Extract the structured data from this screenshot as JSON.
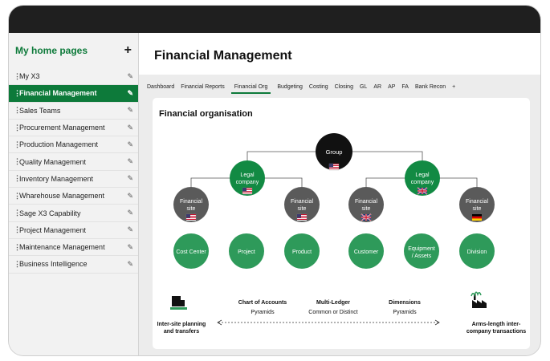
{
  "sidebar": {
    "title": "My home pages",
    "add_icon": "plus-icon",
    "items": [
      {
        "label": "My X3"
      },
      {
        "label": "Financial Management",
        "active": true
      },
      {
        "label": "Sales Teams"
      },
      {
        "label": "Procurement Management"
      },
      {
        "label": "Production Management"
      },
      {
        "label": "Quality Management"
      },
      {
        "label": "Inventory Management"
      },
      {
        "label": "Wharehouse Management"
      },
      {
        "label": "Sage X3 Capability"
      },
      {
        "label": "Project Management"
      },
      {
        "label": "Maintenance Management"
      },
      {
        "label": "Business Intelligence"
      }
    ]
  },
  "page": {
    "title": "Financial Management"
  },
  "tabs": [
    "Dashboard",
    "Financial Reports",
    "Financial Org",
    "Budgeting",
    "Costing",
    "Closing",
    "GL",
    "AR",
    "AP",
    "FA",
    "Bank Recon",
    "+"
  ],
  "active_tab": "Financial Org",
  "card": {
    "title": "Financial organisation"
  },
  "org": {
    "group": {
      "label": "Group"
    },
    "legal": [
      {
        "label1": "Legal",
        "label2": "company",
        "flag": "us"
      },
      {
        "label1": "Legal",
        "label2": "company",
        "flag": "uk"
      }
    ],
    "sites": [
      {
        "label1": "Financial",
        "label2": "site",
        "flag": "us"
      },
      {
        "label1": "Financial",
        "label2": "site",
        "flag": "us"
      },
      {
        "label1": "Financial",
        "label2": "site",
        "flag": "uk"
      },
      {
        "label1": "Financial",
        "label2": "site",
        "flag": "de"
      }
    ],
    "dims": [
      {
        "label1": "Cost Center",
        "label2": ""
      },
      {
        "label1": "Project",
        "label2": ""
      },
      {
        "label1": "Product",
        "label2": ""
      },
      {
        "label1": "Customer",
        "label2": ""
      },
      {
        "label1": "Equipment",
        "label2": "/ Assets"
      },
      {
        "label1": "Division",
        "label2": ""
      }
    ]
  },
  "bottom": {
    "left": {
      "line1": "Inter-site planning",
      "line2": "and transfers",
      "icon": "truck-icon"
    },
    "right": {
      "line1": "Arms-length inter-",
      "line2": "company transactions",
      "icon": "factory-icon"
    },
    "features": [
      {
        "title": "Chart of Accounts",
        "sub": "Pyramids"
      },
      {
        "title": "Multi-Ledger",
        "sub": "Common or Distinct"
      },
      {
        "title": "Dimensions",
        "sub": "Pyramids"
      }
    ]
  },
  "colors": {
    "brand": "#0d7a3a",
    "group": "#111111",
    "legal": "#128a43",
    "site": "#5a5a5a",
    "dim": "#2e9a5a"
  }
}
